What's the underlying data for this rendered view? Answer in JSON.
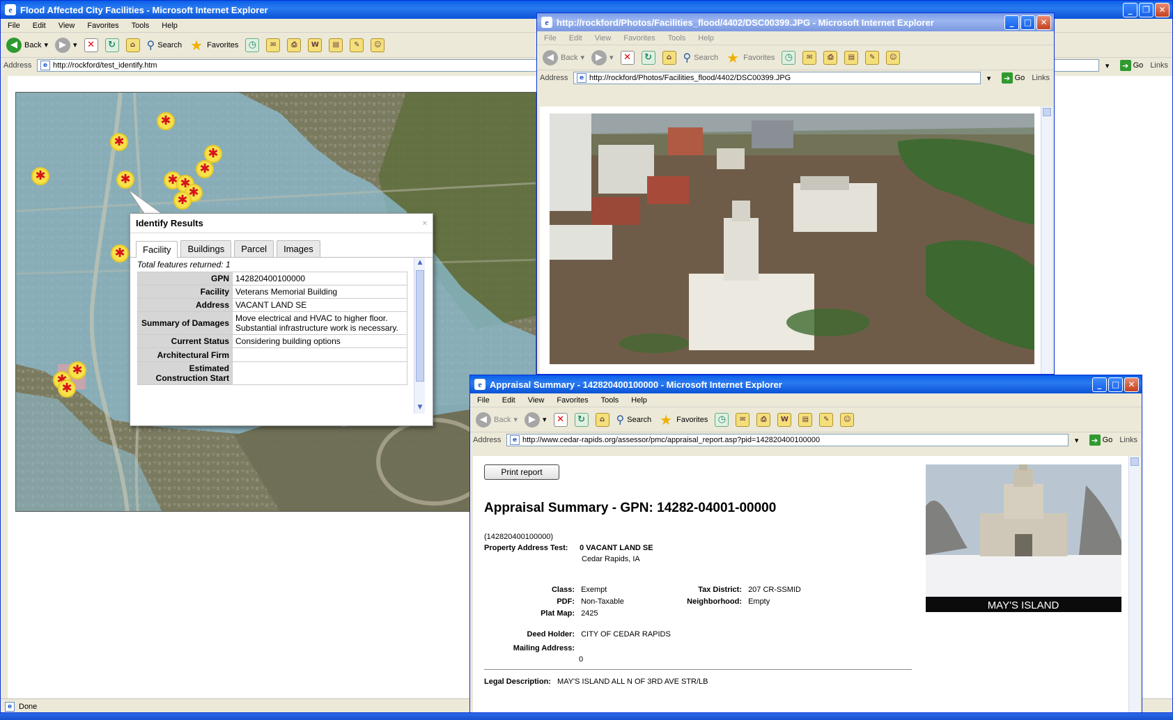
{
  "main_window": {
    "title": "Flood Affected City Facilities - Microsoft Internet Explorer",
    "menu": [
      "File",
      "Edit",
      "View",
      "Favorites",
      "Tools",
      "Help"
    ],
    "toolbar": {
      "back": "Back",
      "search": "Search",
      "favorites": "Favorites"
    },
    "address_label": "Address",
    "url": "http://rockford/test_identify.htm",
    "go_label": "Go",
    "links_label": "Links",
    "status": "Done"
  },
  "identify": {
    "title": "Identify Results",
    "close": "×",
    "tabs": [
      "Facility",
      "Buildings",
      "Parcel",
      "Images"
    ],
    "total": "Total features returned: 1",
    "rows": [
      {
        "key": "GPN",
        "value": "142820400100000"
      },
      {
        "key": "Facility",
        "value": "Veterans Memorial Building"
      },
      {
        "key": "Address",
        "value": "VACANT LAND SE"
      },
      {
        "key": "Summary of Damages",
        "value": "Move electrical and HVAC to higher floor. Substantial infrastructure work is necessary."
      },
      {
        "key": "Current Status",
        "value": "Considering building options"
      },
      {
        "key": "Architectural Firm",
        "value": ""
      },
      {
        "key": "Estimated Construction Start",
        "value": ""
      }
    ]
  },
  "photo_window": {
    "title": "http://rockford/Photos/Facilities_flood/4402/DSC00399.JPG - Microsoft Internet Explorer",
    "menu": [
      "File",
      "Edit",
      "View",
      "Favorites",
      "Tools",
      "Help"
    ],
    "toolbar": {
      "back": "Back",
      "search": "Search",
      "favorites": "Favorites"
    },
    "address_label": "Address",
    "url": "http://rockford/Photos/Facilities_flood/4402/DSC00399.JPG",
    "go_label": "Go",
    "links_label": "Links"
  },
  "appraisal_window": {
    "title": "Appraisal Summary - 142820400100000 - Microsoft Internet Explorer",
    "menu": [
      "File",
      "Edit",
      "View",
      "Favorites",
      "Tools",
      "Help"
    ],
    "toolbar": {
      "back": "Back",
      "search": "Search",
      "favorites": "Favorites"
    },
    "address_label": "Address",
    "url": "http://www.cedar-rapids.org/assessor/pmc/appraisal_report.asp?pid=142820400100000",
    "go_label": "Go",
    "links_label": "Links",
    "print_button": "Print report",
    "heading": "Appraisal Summary - GPN: 14282-04001-00000",
    "pid": "(142820400100000)",
    "property_address_label": "Property Address Test:",
    "property_address_line1": "0 VACANT LAND SE",
    "property_address_line2": "Cedar Rapids, IA",
    "class_label": "Class:",
    "class_value": "Exempt",
    "pdf_label": "PDF:",
    "pdf_value": "Non-Taxable",
    "platmap_label": "Plat Map:",
    "platmap_value": "2425",
    "taxdistrict_label": "Tax District:",
    "taxdistrict_value": "207 CR-SSMID",
    "neighborhood_label": "Neighborhood:",
    "neighborhood_value": "Empty",
    "deedholder_label": "Deed Holder:",
    "deedholder_value": "CITY OF CEDAR RAPIDS",
    "mailing_label": "Mailing Address:",
    "mailing_value": "0",
    "legal_label": "Legal Description:",
    "legal_value": "MAY'S ISLAND ALL N OF 3RD AVE STR/LB",
    "photo_caption": "MAY'S ISLAND"
  }
}
